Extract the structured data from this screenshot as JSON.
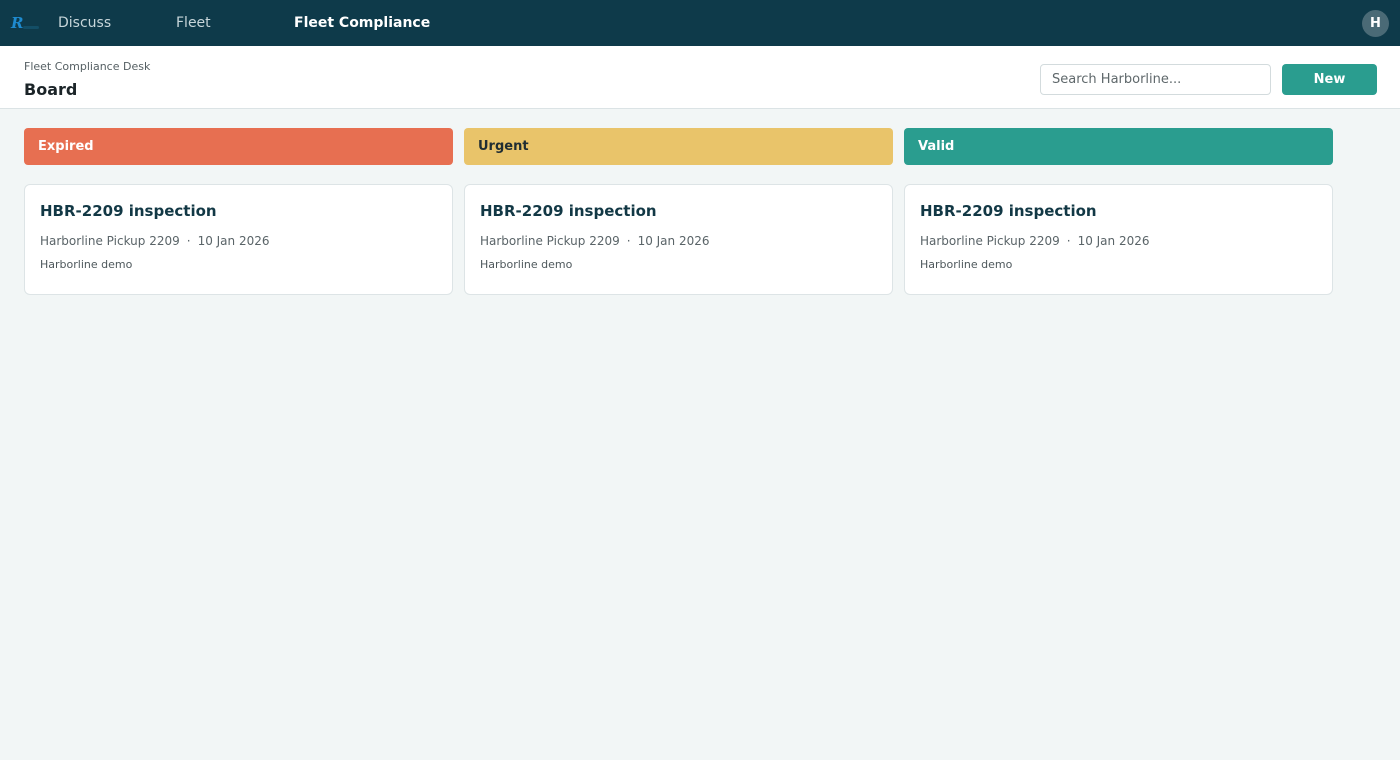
{
  "nav": {
    "items": [
      {
        "label": "Discuss"
      },
      {
        "label": "Fleet"
      },
      {
        "label": "Fleet Compliance"
      }
    ],
    "avatar_initial": "H"
  },
  "header": {
    "breadcrumb": "Fleet Compliance Desk",
    "title": "Board",
    "search_placeholder": "Search Harborline...",
    "new_label": "New"
  },
  "columns": [
    {
      "label": "Expired",
      "color": "#e76f51",
      "text_color": "#ffffff",
      "cards": [
        {
          "title": "HBR-2209 inspection",
          "vehicle": "Harborline Pickup 2209",
          "separator": "·",
          "date": "10 Jan 2026",
          "owner": "Harborline demo"
        }
      ]
    },
    {
      "label": "Urgent",
      "color": "#e9c46a",
      "text_color": "#1f2d33",
      "cards": [
        {
          "title": "HBR-2209 inspection",
          "vehicle": "Harborline Pickup 2209",
          "separator": "·",
          "date": "10 Jan 2026",
          "owner": "Harborline demo"
        }
      ]
    },
    {
      "label": "Valid",
      "color": "#2a9d8f",
      "text_color": "#ffffff",
      "cards": [
        {
          "title": "HBR-2209 inspection",
          "vehicle": "Harborline Pickup 2209",
          "separator": "·",
          "date": "10 Jan 2026",
          "owner": "Harborline demo"
        }
      ]
    }
  ],
  "icons": {
    "logo": "app-logo-icon"
  }
}
